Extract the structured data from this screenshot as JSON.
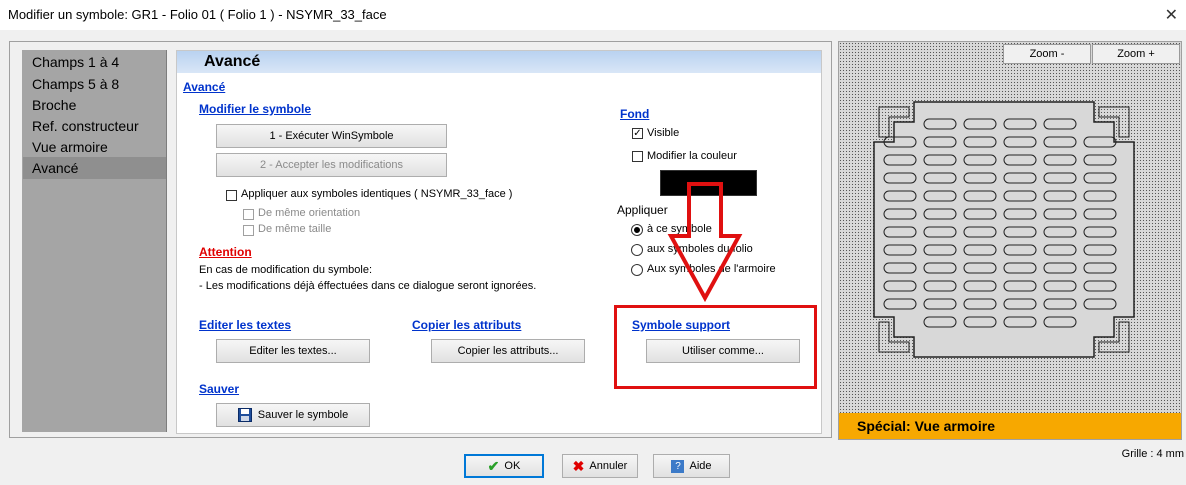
{
  "window": {
    "title": "Modifier un symbole: GR1 - Folio 01 ( Folio 1 ) - NSYMR_33_face",
    "close_glyph": "✕"
  },
  "nav": {
    "items": [
      {
        "label": "Champs 1 à 4"
      },
      {
        "label": "Champs 5 à 8"
      },
      {
        "label": "Broche"
      },
      {
        "label": "Ref. constructeur"
      },
      {
        "label": "Vue armoire"
      },
      {
        "label": "Avancé"
      }
    ],
    "active_index": 5
  },
  "panel": {
    "header": "Avancé",
    "section_link": "Avancé",
    "modify": {
      "title": "Modifier le symbole",
      "btn_exec": "1 - Exécuter WinSymbole",
      "btn_accept": "2 - Accepter les modifications",
      "apply_identical": "Appliquer aux symboles identiques ( NSYMR_33_face )",
      "same_orientation": "De même orientation",
      "same_size": "De même taille"
    },
    "attention": {
      "title": "Attention",
      "line1": "En cas de modification du symbole:",
      "line2": "- Les modifications déjà éffectuées dans ce dialogue seront ignorées."
    },
    "edit_texts": {
      "title": "Editer les textes",
      "button": "Editer les textes..."
    },
    "copy_attrs": {
      "title": "Copier les attributs",
      "button": "Copier les attributs..."
    },
    "save": {
      "title": "Sauver",
      "button": "Sauver le symbole"
    },
    "fond": {
      "title": "Fond",
      "visible": "Visible",
      "visible_checked": true,
      "change_color": "Modifier la couleur",
      "change_color_checked": false,
      "swatch_color": "#000000",
      "apply_label": "Appliquer",
      "options": [
        "à ce symbole",
        "aux symboles du folio",
        "Aux symboles de l'armoire"
      ],
      "selected_index": 0
    },
    "support": {
      "title": "Symbole support",
      "button": "Utiliser comme..."
    }
  },
  "preview": {
    "zoom_minus": "Zoom -",
    "zoom_plus": "Zoom +",
    "banner": "Spécial: Vue armoire",
    "grid": "Grille : 4 mm"
  },
  "footer": {
    "ok": "OK",
    "cancel": "Annuler",
    "help": "Aide"
  },
  "colors": {
    "highlight": "#e01010",
    "arrow": "#e01010",
    "banner": "#f7a800",
    "link": "#0033cc"
  }
}
